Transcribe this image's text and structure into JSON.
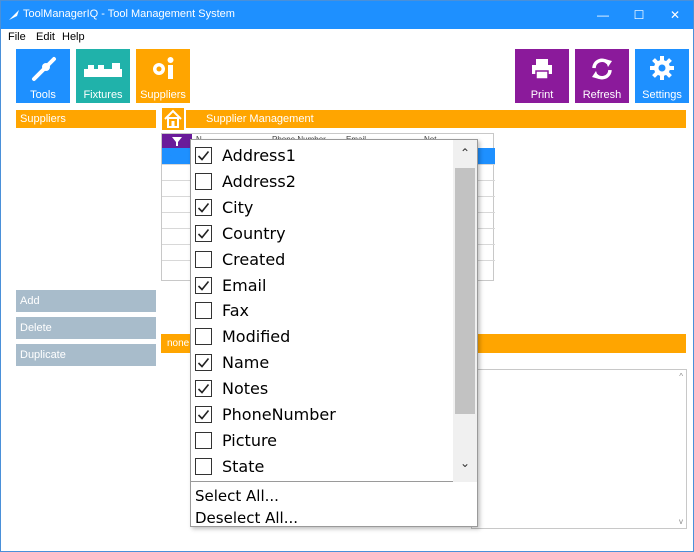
{
  "window": {
    "title": "ToolManagerIQ - Tool Management System",
    "min": "—",
    "max": "☐",
    "close": "✕"
  },
  "menu": [
    "File",
    "Edit",
    "Help"
  ],
  "toolbar": {
    "tools": "Tools",
    "fixtures": "Fixtures",
    "suppliers": "Suppliers",
    "print": "Print",
    "refresh": "Refresh",
    "settings": "Settings"
  },
  "colors": {
    "titlebar": "#1e90ff",
    "tools_tile": "#1e90ff",
    "fixtures_tile": "#20b2aa",
    "suppliers_tile": "#ffa500",
    "print_tile": "#8b1a9b",
    "refresh_tile": "#8b1a9b",
    "settings_tile": "#1e90ff",
    "accent": "#ffa500",
    "side_button": "#a8bccb"
  },
  "left_panel": {
    "header": "Suppliers"
  },
  "main_panel": {
    "header": "Supplier Management"
  },
  "side_buttons": {
    "add": "Add",
    "delete": "Delete",
    "duplicate": "Duplicate"
  },
  "grid": {
    "headers": [
      "N...",
      "Phone Number",
      "Email",
      "Not..."
    ]
  },
  "detail_bar": "none",
  "column_chooser": {
    "items": [
      {
        "label": "Address1",
        "checked": true
      },
      {
        "label": "Address2",
        "checked": false
      },
      {
        "label": "City",
        "checked": true
      },
      {
        "label": "Country",
        "checked": true
      },
      {
        "label": "Created",
        "checked": false
      },
      {
        "label": "Email",
        "checked": true
      },
      {
        "label": "Fax",
        "checked": false
      },
      {
        "label": "Modified",
        "checked": false
      },
      {
        "label": "Name",
        "checked": true
      },
      {
        "label": "Notes",
        "checked": true
      },
      {
        "label": "PhoneNumber",
        "checked": true
      },
      {
        "label": "Picture",
        "checked": false
      },
      {
        "label": "State",
        "checked": false
      }
    ],
    "select_all": "Select All...",
    "deselect_all": "Deselect All..."
  }
}
